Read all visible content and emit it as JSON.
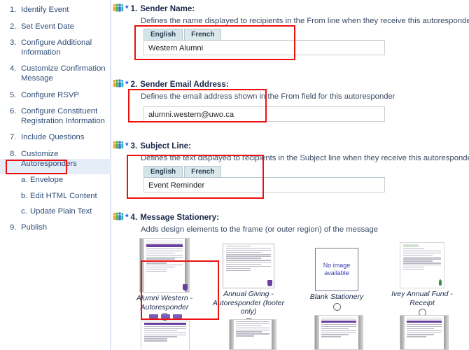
{
  "sidebar": {
    "items": [
      {
        "num": "1.",
        "label": "Identify Event",
        "sub": false
      },
      {
        "num": "2.",
        "label": "Set Event Date",
        "sub": false
      },
      {
        "num": "3.",
        "label": "Configure Additional Information",
        "sub": false
      },
      {
        "num": "4.",
        "label": "Customize Confirmation Message",
        "sub": false
      },
      {
        "num": "5.",
        "label": "Configure RSVP",
        "sub": false
      },
      {
        "num": "6.",
        "label": "Configure Constituent Registration Information",
        "sub": false
      },
      {
        "num": "7.",
        "label": "Include Questions",
        "sub": false
      },
      {
        "num": "8.",
        "label": "Customize Autoresponders",
        "sub": false
      },
      {
        "num": "a.",
        "label": "Envelope",
        "sub": true
      },
      {
        "num": "b.",
        "label": "Edit HTML Content",
        "sub": true
      },
      {
        "num": "c.",
        "label": "Update Plain Text",
        "sub": true
      },
      {
        "num": "9.",
        "label": "Publish",
        "sub": false
      }
    ],
    "selected": "Envelope",
    "highlight_color": "#e5edf8",
    "text_color": "#2f4d78"
  },
  "annotation": {
    "color": "#ee1111",
    "boxes": [
      {
        "name": "envelope-nav-highlight"
      },
      {
        "name": "sender-name-field-highlight"
      },
      {
        "name": "sender-email-field-highlight"
      },
      {
        "name": "subject-line-field-highlight"
      },
      {
        "name": "stationery-selection-highlight"
      }
    ]
  },
  "sections": [
    {
      "num": "1.",
      "title": "Sender Name:",
      "required_marker": "*",
      "icon": "people-group-icon",
      "description": "Defines the name displayed to recipients in the From line when they receive this autoresponder",
      "has_tabs": true,
      "tabs": [
        {
          "label": "English",
          "active": true
        },
        {
          "label": "French",
          "active": false
        }
      ],
      "value": "Western Alumni",
      "placeholder": ""
    },
    {
      "num": "2.",
      "title": "Sender Email Address:",
      "required_marker": "*",
      "icon": "people-group-icon",
      "description": "Defines the email address shown in the From field for this autoresponder",
      "has_tabs": false,
      "tabs": [],
      "value": "alumni.western@uwo.ca",
      "placeholder": ""
    },
    {
      "num": "3.",
      "title": "Subject Line:",
      "required_marker": "*",
      "icon": "people-group-icon",
      "description": "Defines the text displayed to recipients in the Subject line when they receive this autoresponder",
      "has_tabs": true,
      "tabs": [
        {
          "label": "English",
          "active": true
        },
        {
          "label": "French",
          "active": false
        }
      ],
      "value": "Event Reminder",
      "placeholder": ""
    }
  ],
  "stationery_section": {
    "num": "4.",
    "title": "Message Stationery:",
    "required_marker": "*",
    "icon": "people-group-icon",
    "description": "Adds design elements to the frame (or outer region) of the message",
    "options": [
      {
        "label": "Alumni Western - Autoresponder",
        "selected": true,
        "thumb": "western-newsletter-thumb"
      },
      {
        "label": "Annual Giving - Autoresponder (footer only)",
        "selected": false,
        "thumb": "annual-giving-thumb"
      },
      {
        "label": "Blank Stationery",
        "selected": false,
        "thumb": "no-image-available",
        "no_image_text": "No image available"
      },
      {
        "label": "Ivey Annual Fund - Receipt",
        "selected": false,
        "thumb": "ivey-receipt-thumb"
      }
    ]
  }
}
